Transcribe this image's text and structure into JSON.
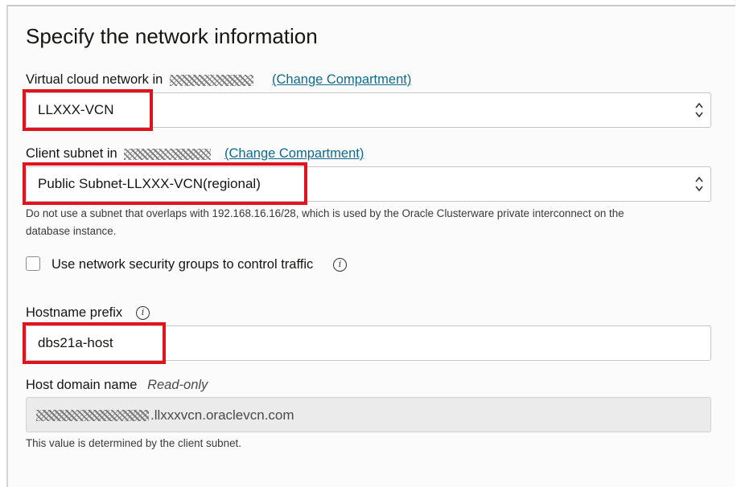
{
  "section": {
    "title": "Specify the network information"
  },
  "vcn": {
    "label": "Virtual cloud network in",
    "change_link": "(Change Compartment)",
    "selected": "LLXXX-VCN"
  },
  "subnet": {
    "label": "Client subnet in",
    "change_link": "(Change Compartment)",
    "selected": "Public Subnet-LLXXX-VCN(regional)",
    "help_line1": "Do not use a subnet that overlaps with 192.168.16.16/28, which is used by the Oracle Clusterware private interconnect on the",
    "help_line2": "database instance."
  },
  "nsg": {
    "label": "Use network security groups to control traffic",
    "checked": false
  },
  "hostname": {
    "label": "Hostname prefix",
    "value": "dbs21a-host"
  },
  "domain": {
    "label": "Host domain name",
    "readonly_tag": "Read-only",
    "value_suffix": ".llxxxvcn.oraclevcn.com",
    "help": "This value is determined by the client subnet."
  },
  "colors": {
    "link": "#0f6a8c",
    "highlight": "#e0141e",
    "readonly_bg": "#ebebeb"
  },
  "icons": {
    "select_chevron": "chevron-up-down-icon",
    "info": "info-icon"
  }
}
